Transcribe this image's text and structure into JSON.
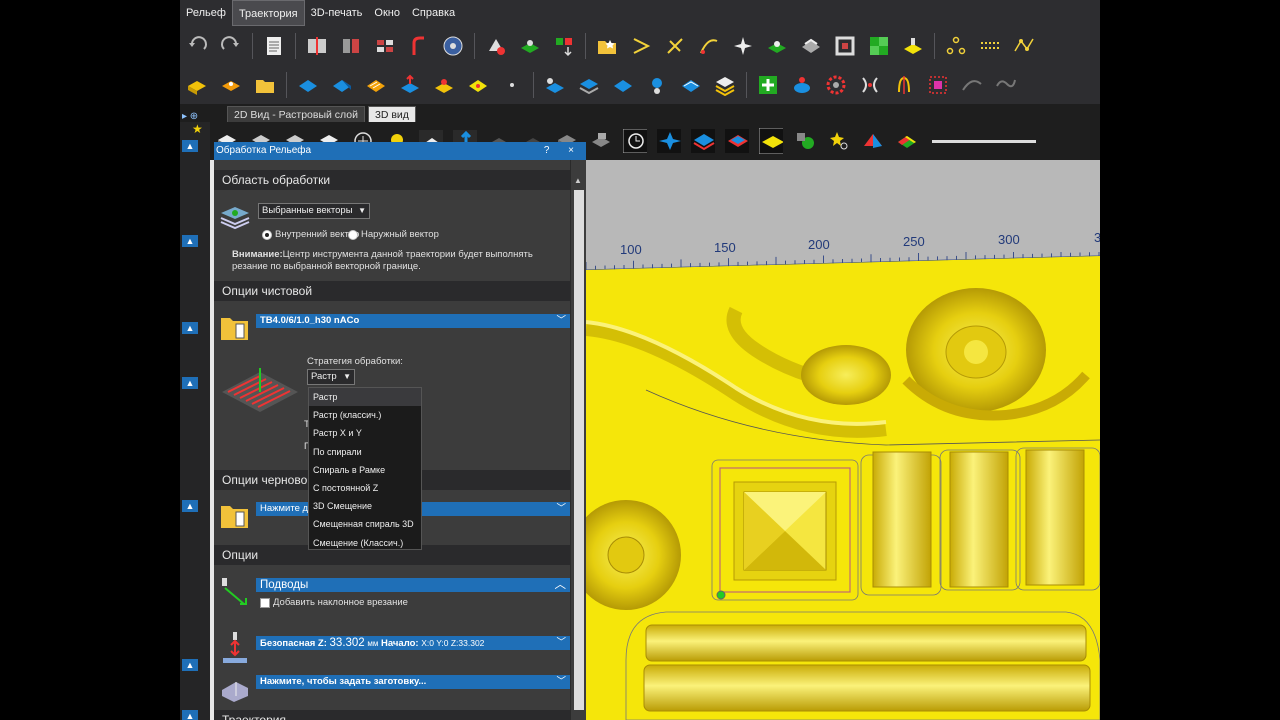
{
  "menu": [
    "Рельеф",
    "Траектория",
    "3D-печать",
    "Окно",
    "Справка"
  ],
  "menu_active": "Траектория",
  "tabs": {
    "pin": "▸ ⊕",
    "tab1": "2D Вид - Растровый слой",
    "tab2": "3D вид"
  },
  "panel": {
    "title": "Обработка Рельефа",
    "title_controls": "? ×",
    "section_area": "Область обработки",
    "area_select": "Выбранные векторы",
    "radio_inner": "Внутренний вектор",
    "radio_outer": "Наружный вектор",
    "warning_bold": "Внимание:",
    "warning_text": "Центр инструмента данной траектории будет выполнять",
    "warning_text2": "резание по выбранной векторной границе.",
    "section_finish": "Опции чистовой",
    "finish_tool": "ТВ4.0/6/1.0_h30 nACo",
    "strategy_label": "Стратегия обработки:",
    "strategy_value": "Растр",
    "partial1": "Т",
    "partial2": "П",
    "section_rough": "Опции черново",
    "rough_tool": "Нажмите дл",
    "section_options": "Опции",
    "approach_label": "Подводы",
    "ramp_label": "Добавить наклонное врезание",
    "safe_z_label": "Безопасная Z:",
    "safe_z_value": "33.302",
    "safe_z_unit": "мм",
    "start_label": "Начало:",
    "start_value": "X:0 Y:0 Z:33.302",
    "stock_label": "Нажмите, чтобы задать заготовку...",
    "section_toolpath": "Траектория"
  },
  "strategy_options": [
    "Растр",
    "Растр (классич.)",
    "Растр X и Y",
    "По спирали",
    "Спираль в Рамке",
    "С постоянной Z",
    "3D Смещение",
    "Смещенная спираль 3D",
    "Смещение (Классич.)"
  ],
  "ruler": {
    "labels": [
      "100",
      "150",
      "200",
      "250",
      "300",
      "3"
    ]
  },
  "colors": {
    "accent": "#1f6fb7",
    "relief": "#f5e60a",
    "toolbar": "#2d2d30"
  }
}
